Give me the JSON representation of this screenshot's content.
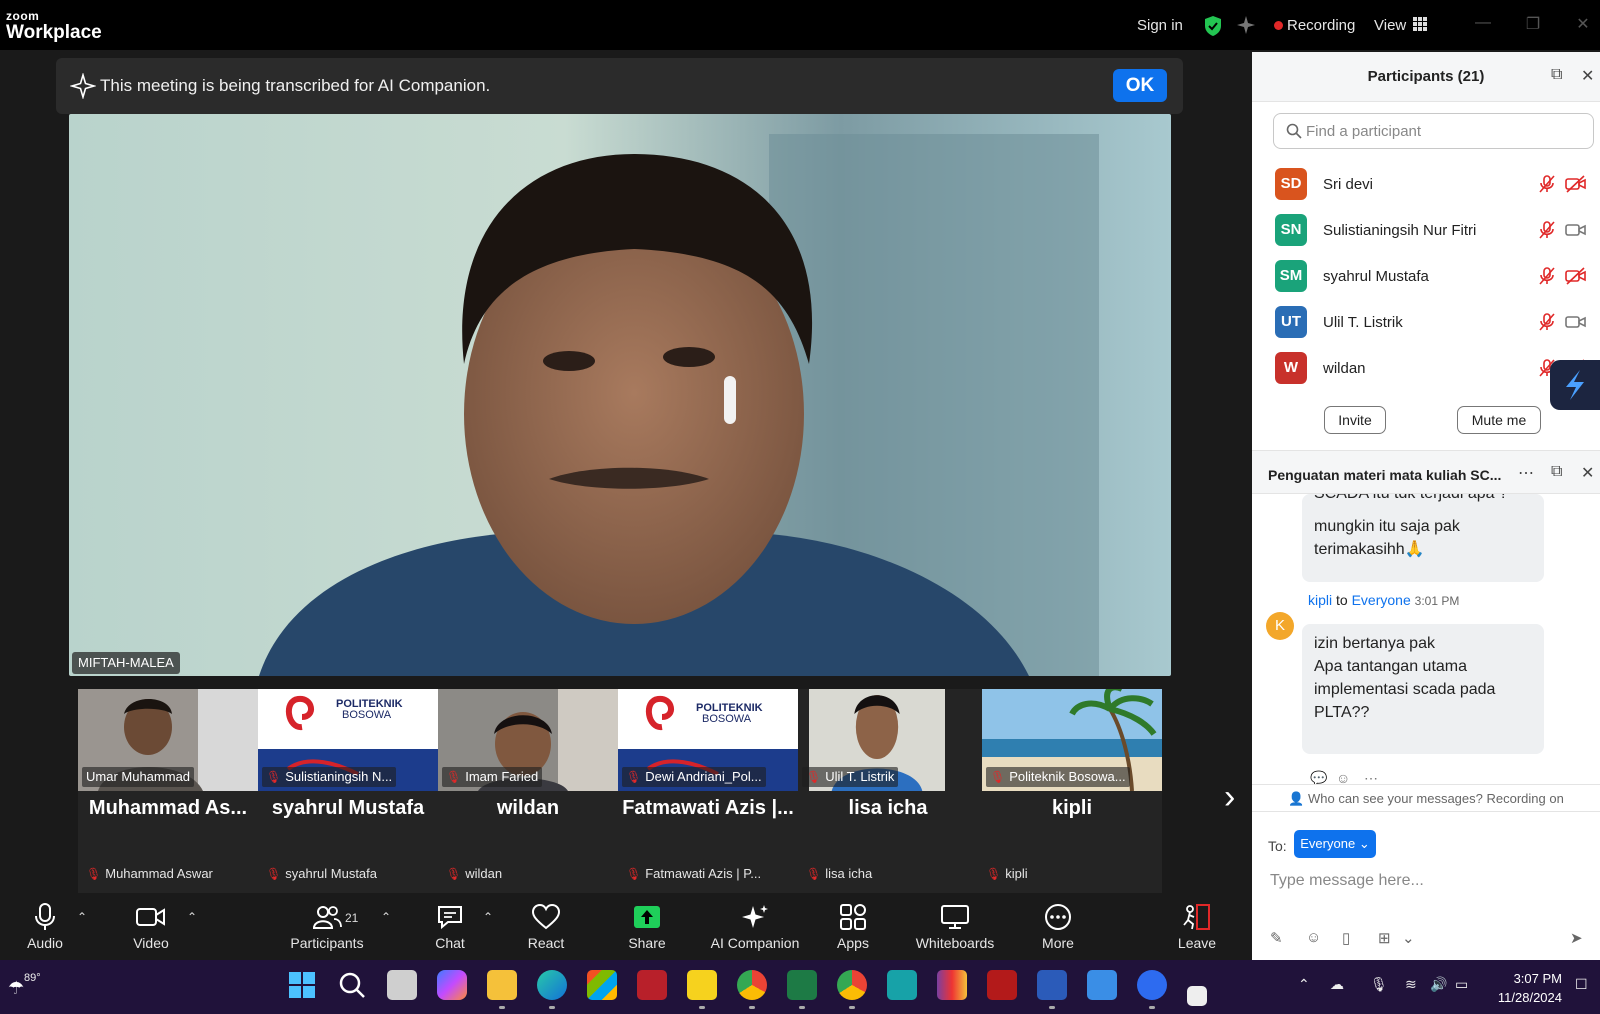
{
  "titlebar": {
    "logo_small": "zoom",
    "logo_large": "Workplace",
    "sign_in": "Sign in",
    "recording": "Recording",
    "view": "View"
  },
  "banner": {
    "text": "This meeting is being transcribed for AI Companion.",
    "ok": "OK"
  },
  "main_video": {
    "name": "MIFTAH-MALEA"
  },
  "thumbnails": [
    {
      "label": "Umar Muhammad"
    },
    {
      "label": "Sulistianingsih N..."
    },
    {
      "label": "Imam Faried"
    },
    {
      "label": "Dewi Andriani_Pol..."
    },
    {
      "label": "Ulil T. Listrik"
    },
    {
      "label": "Politeknik Bosowa..."
    }
  ],
  "logo_text": {
    "line1": "POLITEKNIK",
    "line2": "BOSOWA"
  },
  "name_tiles": [
    {
      "title": "Muhammad  As...",
      "sub": "Muhammad Aswar"
    },
    {
      "title": "syahrul Mustafa",
      "sub": "syahrul Mustafa"
    },
    {
      "title": "wildan",
      "sub": "wildan"
    },
    {
      "title": "Fatmawati Azis |...",
      "sub": "Fatmawati Azis | P..."
    },
    {
      "title": "lisa icha",
      "sub": "lisa icha"
    },
    {
      "title": "kipli",
      "sub": "kipli"
    }
  ],
  "toolbar": {
    "audio": "Audio",
    "video": "Video",
    "participants": "Participants",
    "participants_count": "21",
    "chat": "Chat",
    "react": "React",
    "share": "Share",
    "ai_companion": "AI Companion",
    "apps": "Apps",
    "whiteboards": "Whiteboards",
    "more": "More",
    "leave": "Leave"
  },
  "participants_panel": {
    "title": "Participants (21)",
    "search_placeholder": "Find a participant",
    "list": [
      {
        "initials": "SD",
        "name": "Sri devi",
        "color": "#d9541e",
        "video_off": true
      },
      {
        "initials": "SN",
        "name": "Sulistianingsih Nur Fitri",
        "color": "#1aa37a",
        "video_off": false
      },
      {
        "initials": "SM",
        "name": "syahrul Mustafa",
        "color": "#1aa37a",
        "video_off": true
      },
      {
        "initials": "UT",
        "name": "Ulil T. Listrik",
        "color": "#2a6db5",
        "video_off": false
      },
      {
        "initials": "W",
        "name": "wildan",
        "color": "#c8312b",
        "video_off": true
      }
    ],
    "invite": "Invite",
    "mute_me": "Mute me"
  },
  "chat_panel": {
    "title": "Penguatan materi mata kuliah SC...",
    "prev_message_partial": "SCADA itu tdk terjadi apa ?",
    "prev_message_line2": "mungkin itu saja pak",
    "prev_message_line3": "terimakasihh🙏",
    "sender": "kipli",
    "to_word": "to",
    "recipient": "Everyone",
    "time": "3:01 PM",
    "sender_initial": "K",
    "message_lines": [
      "izin bertanya pak",
      "Apa tantangan utama",
      "implementasi scada pada",
      "PLTA??"
    ],
    "visibility_note": "Who can see your messages? Recording on",
    "to_label": "To:",
    "to_value": "Everyone",
    "input_placeholder": "Type message here..."
  },
  "taskbar": {
    "temperature": "89°",
    "time": "3:07 PM",
    "date": "11/28/2024"
  },
  "colors": {
    "accent": "#0e72ed",
    "recording": "#e02828",
    "muted": "#e02828",
    "share_green": "#1fcf5a"
  }
}
